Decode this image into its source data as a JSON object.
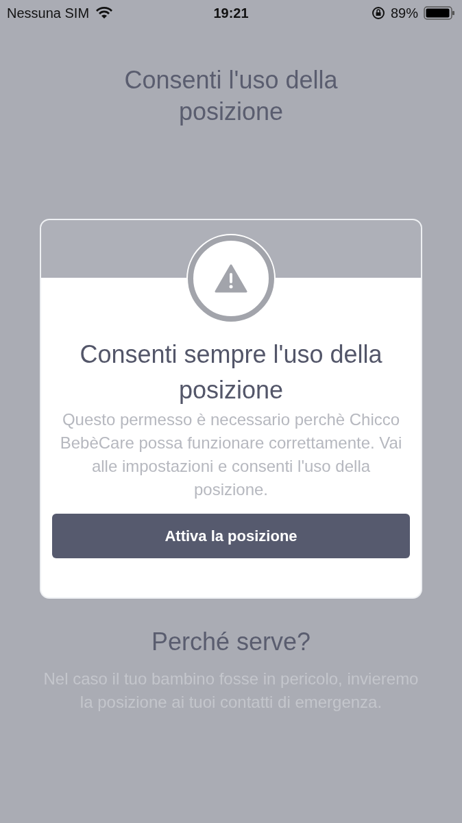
{
  "status_bar": {
    "carrier": "Nessuna SIM",
    "time": "19:21",
    "battery": "89%"
  },
  "title": "Consenti l'uso della posizione",
  "dialog": {
    "title": "Consenti sempre l'uso della posizione",
    "message": "Questo permesso è necessario perchè Chicco BebèCare possa funzionare correttamente. Vai alle impostazioni e consenti l'uso della posizione.",
    "button": "Attiva la posizione"
  },
  "info": {
    "heading": "Perché serve?",
    "text": "Nel caso il tuo bambino fosse in pericolo, invieremo la posizione ai tuoi contatti di emergenza."
  }
}
